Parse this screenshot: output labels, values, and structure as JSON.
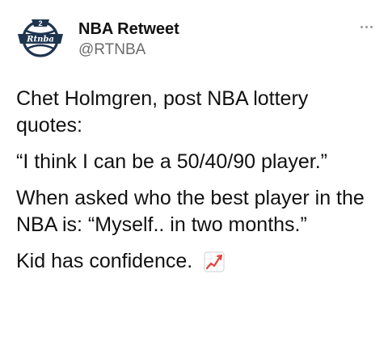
{
  "tweet": {
    "author": {
      "display_name": "NBA Retweet",
      "handle": "@RTNBA",
      "avatar_logo_text": "Rtnba",
      "avatar_logo_number": "2"
    },
    "paragraphs": [
      "Chet Holmgren, post NBA lottery quotes:",
      "“I think I can be a 50/40/90 player.”",
      "When asked who the best player in the NBA is: “Myself.. in two months.”",
      "Kid has confidence."
    ],
    "emoji": "chart-increasing-icon",
    "colors": {
      "text": "#111111",
      "handle": "#6b6b6b",
      "logo": "#1e3550",
      "emoji_line": "#e0453a"
    }
  }
}
